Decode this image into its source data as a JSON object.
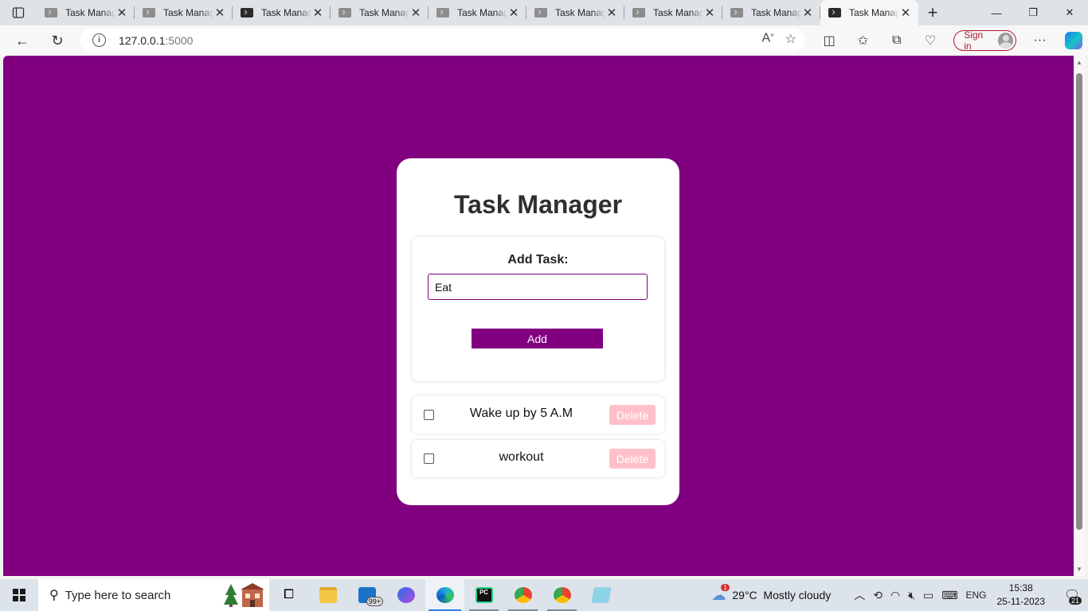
{
  "browser": {
    "tabs": [
      {
        "title": "Task Manager",
        "active": false,
        "icon": "page-icon"
      },
      {
        "title": "Task Manager",
        "active": false,
        "icon": "page-icon"
      },
      {
        "title": "Task Manager",
        "active": false,
        "icon": "terminal-icon"
      },
      {
        "title": "Task Manager",
        "active": false,
        "icon": "page-icon"
      },
      {
        "title": "Task Manager",
        "active": false,
        "icon": "page-icon"
      },
      {
        "title": "Task Manager",
        "active": false,
        "icon": "page-icon"
      },
      {
        "title": "Task Manager",
        "active": false,
        "icon": "page-icon"
      },
      {
        "title": "Task Manager",
        "active": false,
        "icon": "page-icon"
      },
      {
        "title": "Task Manager",
        "active": true,
        "icon": "terminal-icon"
      }
    ],
    "url_host": "127.0.0.1",
    "url_port": ":5000",
    "sign_in_label": "Sign in"
  },
  "page": {
    "title": "Task Manager",
    "add_label": "Add Task:",
    "input_value": "Eat",
    "add_button": "Add",
    "tasks": [
      {
        "text": "Wake up by 5 A.M",
        "delete_label": "Delete",
        "checked": false
      },
      {
        "text": "workout",
        "delete_label": "Delete",
        "checked": false
      }
    ]
  },
  "taskbar": {
    "search_placeholder": "Type here to search",
    "mail_badge": "99+",
    "weather_badge": "1",
    "weather": "29°C  Mostly cloudy",
    "language": "ENG",
    "time": "15:38",
    "date": "25-11-2023",
    "notification_count": "21"
  },
  "colors": {
    "accent": "#800080",
    "delete_button": "#ffc0cb",
    "sign_in": "#b0192a"
  }
}
